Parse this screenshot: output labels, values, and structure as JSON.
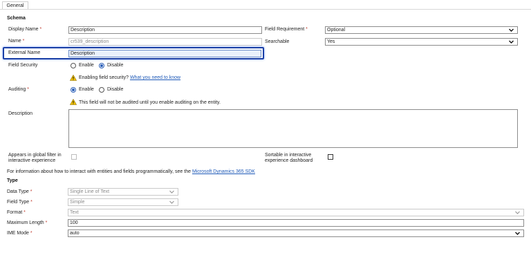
{
  "tab": {
    "label": "General"
  },
  "schema": {
    "heading": "Schema",
    "display_name": {
      "label": "Display Name",
      "value": "Description"
    },
    "name": {
      "label": "Name",
      "value": "cr539_description"
    },
    "external_name": {
      "label": "External Name",
      "value": "Description"
    },
    "field_requirement": {
      "label": "Field Requirement",
      "value": "Optional"
    },
    "searchable": {
      "label": "Searchable",
      "value": "Yes"
    },
    "field_security": {
      "label": "Field Security",
      "enable": "Enable",
      "disable": "Disable",
      "selected": "Disable"
    },
    "field_security_warning": {
      "text": "Enabling field security?",
      "link": "What you need to know"
    },
    "auditing": {
      "label": "Auditing",
      "enable": "Enable",
      "disable": "Disable",
      "selected": "Enable"
    },
    "auditing_warning": "This field will not be audited until you enable auditing on the entity.",
    "description": {
      "label": "Description",
      "value": ""
    },
    "global_filter": {
      "label_line1": "Appears in global filter in",
      "label_line2": "interactive experience",
      "checked": false
    },
    "sortable": {
      "label_line1": "Sortable in interactive",
      "label_line2": "experience dashboard",
      "checked": false
    },
    "info": {
      "text": "For information about how to interact with entities and fields programmatically, see the",
      "link": "Microsoft Dynamics 365 SDK"
    }
  },
  "type": {
    "heading": "Type",
    "data_type": {
      "label": "Data Type",
      "value": "Single Line of Text"
    },
    "field_type": {
      "label": "Field Type",
      "value": "Simple"
    },
    "format": {
      "label": "Format",
      "value": "Text"
    },
    "max_length": {
      "label": "Maximum Length",
      "value": "100"
    },
    "ime_mode": {
      "label": "IME Mode",
      "value": "auto"
    }
  },
  "colors": {
    "required": "#c0392b",
    "highlight": "#1a3fa6",
    "link": "#1f5ab8",
    "warning": "#f2c200"
  }
}
